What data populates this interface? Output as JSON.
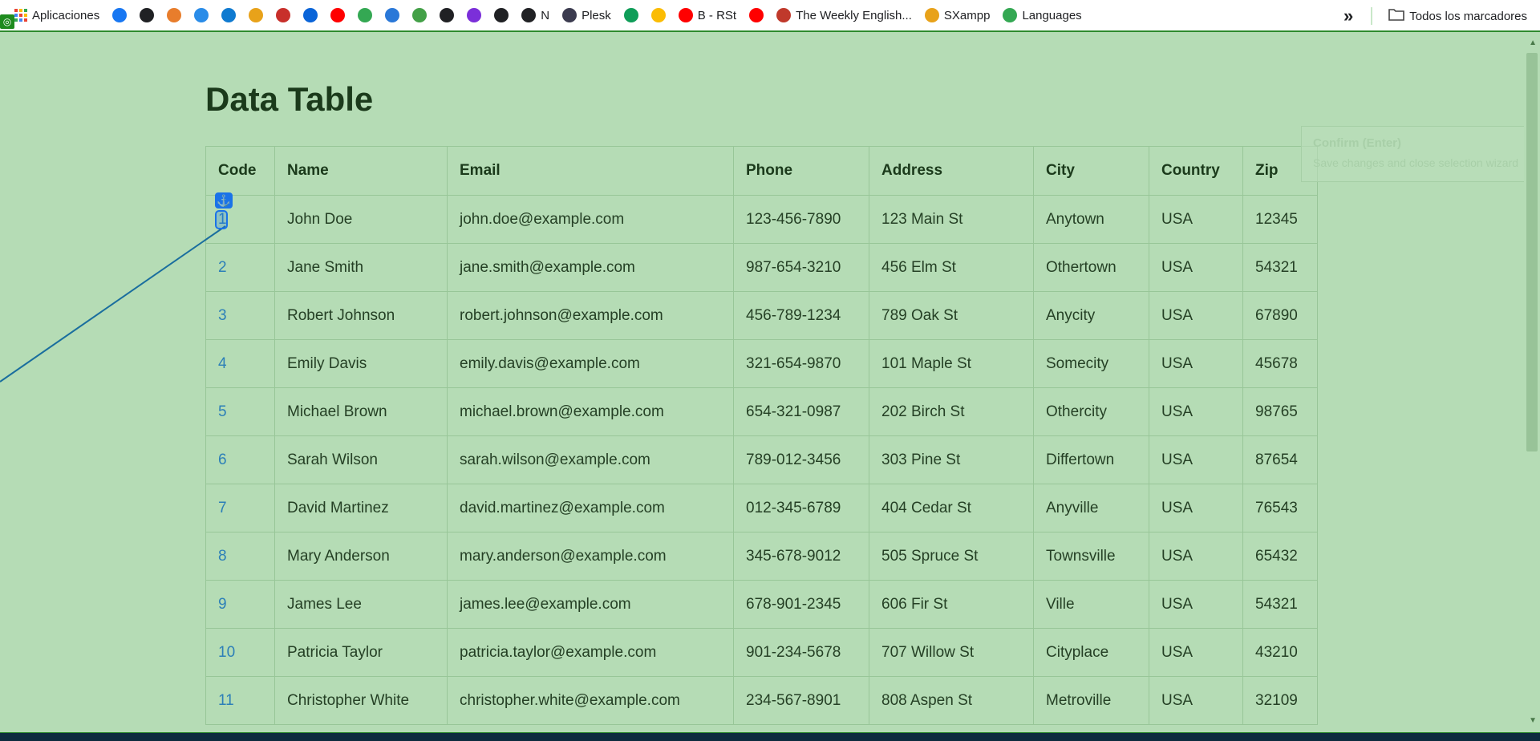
{
  "bookmarks": {
    "apps_label": "Aplicaciones",
    "items": [
      {
        "label": "",
        "icon": "facebook-icon",
        "color": "#1877f2"
      },
      {
        "label": "",
        "icon": "globe-icon",
        "color": "#202124"
      },
      {
        "label": "",
        "icon": "bird-icon",
        "color": "#e87d2c"
      },
      {
        "label": "",
        "icon": "edge-icon",
        "color": "#2a8ce8"
      },
      {
        "label": "",
        "icon": "k-icon",
        "color": "#0f7ad0"
      },
      {
        "label": "",
        "icon": "pma-icon",
        "color": "#e8a21a"
      },
      {
        "label": "",
        "icon": "pdf-icon",
        "color": "#c8302b"
      },
      {
        "label": "",
        "icon": "cloud-icon",
        "color": "#0a64d8"
      },
      {
        "label": "",
        "icon": "youtube-icon",
        "color": "#ff0000"
      },
      {
        "label": "",
        "icon": "maps-icon",
        "color": "#34a853"
      },
      {
        "label": "",
        "icon": "cloud-icon",
        "color": "#2a78d8"
      },
      {
        "label": "",
        "icon": "clover-icon",
        "color": "#43a047"
      },
      {
        "label": "",
        "icon": "github-icon",
        "color": "#202124"
      },
      {
        "label": "",
        "icon": "u-icon",
        "color": "#7b2fd9"
      },
      {
        "label": "",
        "icon": "globe-icon",
        "color": "#202124"
      },
      {
        "label": "N",
        "icon": "github-icon",
        "color": "#202124"
      },
      {
        "label": "Plesk",
        "icon": "plesk-icon",
        "color": "#3b3b4f"
      },
      {
        "label": "",
        "icon": "sheets-icon",
        "color": "#0f9d58"
      },
      {
        "label": "",
        "icon": "drive-icon",
        "color": "#fbbc04"
      },
      {
        "label": "B - RSt",
        "icon": "youtube-icon",
        "color": "#ff0000"
      },
      {
        "label": "",
        "icon": "youtube-icon",
        "color": "#ff0000"
      },
      {
        "label": "The Weekly English...",
        "icon": "flag-icon",
        "color": "#c0392b"
      },
      {
        "label": "SXampp",
        "icon": "st-icon",
        "color": "#e8a21a"
      },
      {
        "label": "Languages",
        "icon": "drive-icon",
        "color": "#34a853"
      }
    ],
    "more_label": "»",
    "all_bookmarks": "Todos los marcadores"
  },
  "page": {
    "title": "Data Table"
  },
  "table": {
    "headers": [
      "Code",
      "Name",
      "Email",
      "Phone",
      "Address",
      "City",
      "Country",
      "Zip"
    ],
    "rows": [
      [
        "1",
        "John Doe",
        "john.doe@example.com",
        "123-456-7890",
        "123 Main St",
        "Anytown",
        "USA",
        "12345"
      ],
      [
        "2",
        "Jane Smith",
        "jane.smith@example.com",
        "987-654-3210",
        "456 Elm St",
        "Othertown",
        "USA",
        "54321"
      ],
      [
        "3",
        "Robert Johnson",
        "robert.johnson@example.com",
        "456-789-1234",
        "789 Oak St",
        "Anycity",
        "USA",
        "67890"
      ],
      [
        "4",
        "Emily Davis",
        "emily.davis@example.com",
        "321-654-9870",
        "101 Maple St",
        "Somecity",
        "USA",
        "45678"
      ],
      [
        "5",
        "Michael Brown",
        "michael.brown@example.com",
        "654-321-0987",
        "202 Birch St",
        "Othercity",
        "USA",
        "98765"
      ],
      [
        "6",
        "Sarah Wilson",
        "sarah.wilson@example.com",
        "789-012-3456",
        "303 Pine St",
        "Differtown",
        "USA",
        "87654"
      ],
      [
        "7",
        "David Martinez",
        "david.martinez@example.com",
        "012-345-6789",
        "404 Cedar St",
        "Anyville",
        "USA",
        "76543"
      ],
      [
        "8",
        "Mary Anderson",
        "mary.anderson@example.com",
        "345-678-9012",
        "505 Spruce St",
        "Townsville",
        "USA",
        "65432"
      ],
      [
        "9",
        "James Lee",
        "james.lee@example.com",
        "678-901-2345",
        "606 Fir St",
        "Ville",
        "USA",
        "54321"
      ],
      [
        "10",
        "Patricia Taylor",
        "patricia.taylor@example.com",
        "901-234-5678",
        "707 Willow St",
        "Cityplace",
        "USA",
        "43210"
      ],
      [
        "11",
        "Christopher White",
        "christopher.white@example.com",
        "234-567-8901",
        "808 Aspen St",
        "Metroville",
        "USA",
        "32109"
      ]
    ]
  },
  "tooltip": {
    "title": "Confirm (Enter)",
    "subtitle": "Save changes and close selection wizard"
  },
  "colors": {
    "page_bg": "#b5dcb5",
    "link": "#2c7fb8",
    "accent": "#1a73e8"
  }
}
